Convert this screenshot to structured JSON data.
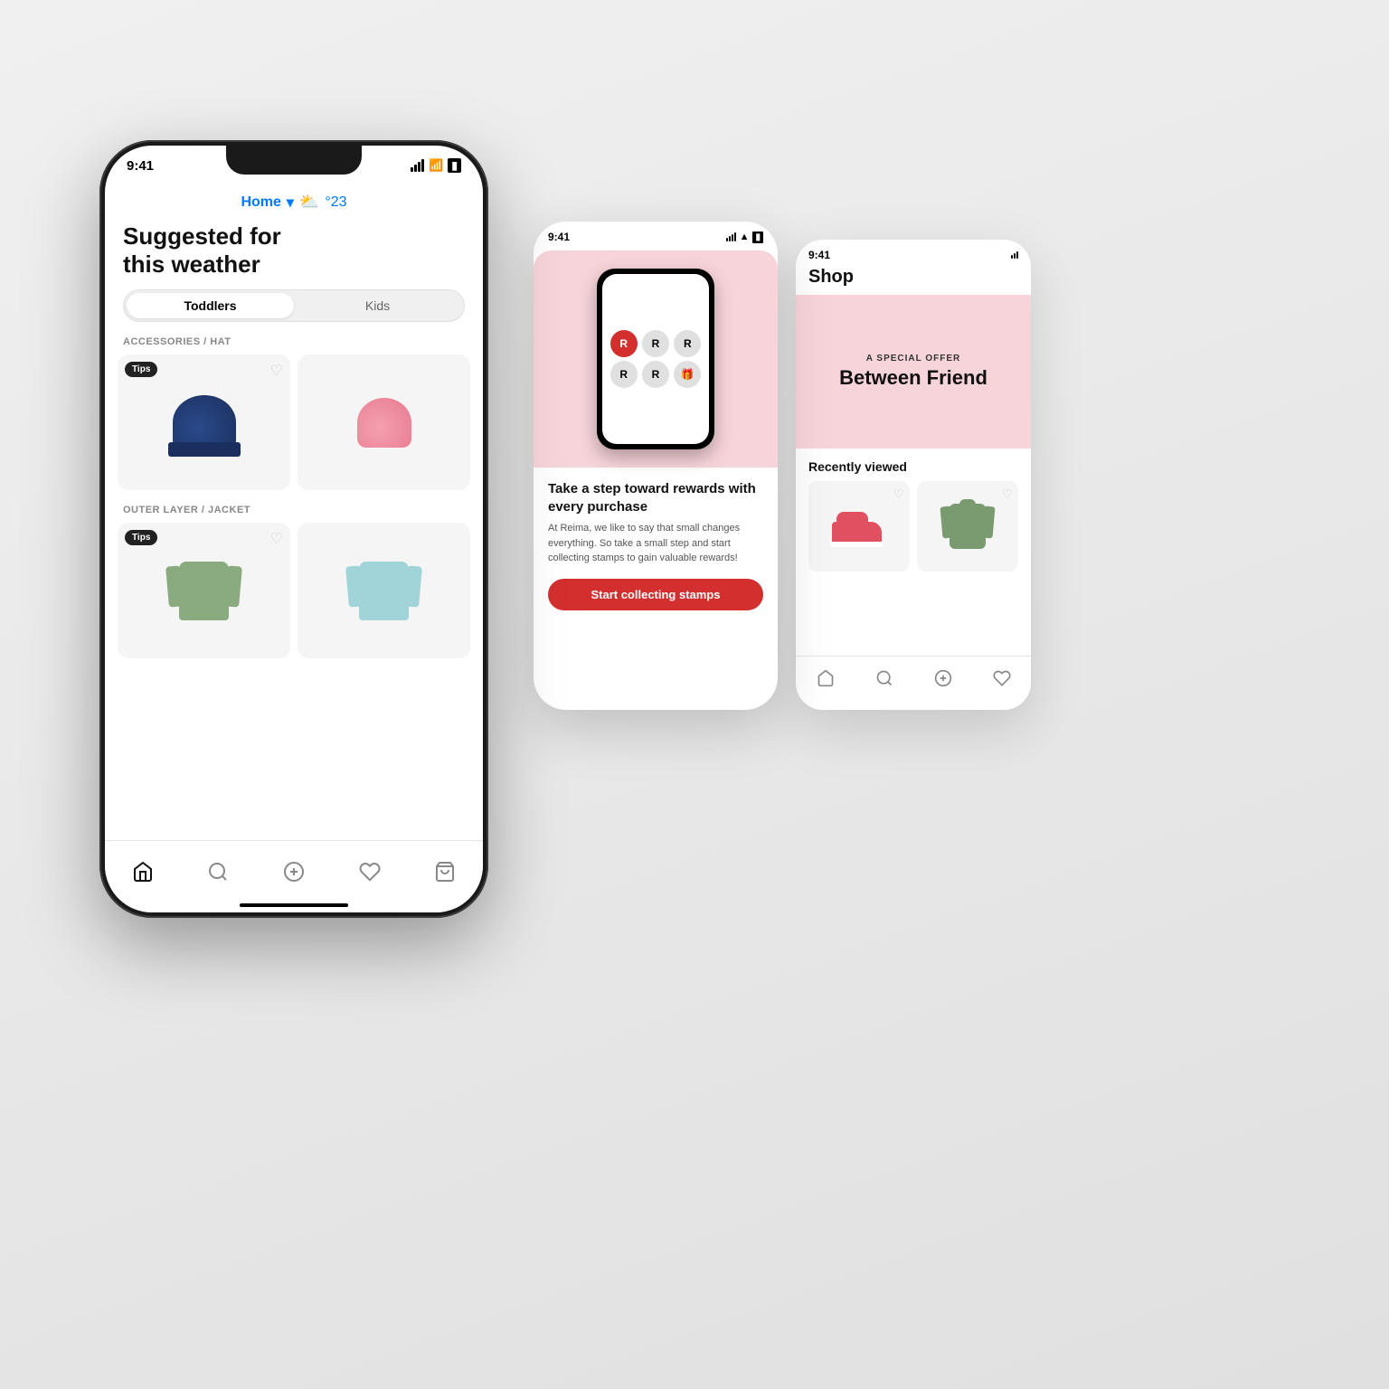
{
  "background": {
    "color": "#e8e8e8"
  },
  "main_phone": {
    "status_bar": {
      "time": "9:41",
      "signal": "signal",
      "wifi": "wifi",
      "battery": "battery"
    },
    "location": {
      "label": "Home",
      "arrow": "▾",
      "weather_emoji": "⛅",
      "temperature": "°23"
    },
    "title": "Suggested for\nthis weather",
    "tabs": [
      "Toddlers",
      "Kids"
    ],
    "active_tab": 0,
    "sections": [
      {
        "category": "ACCESSORIES / HAT",
        "has_tips": true,
        "tips_label": "Tips"
      },
      {
        "category": "OUTER LAYER / JACKET",
        "has_tips": true,
        "tips_label": "Tips"
      }
    ],
    "nav": [
      "🏠",
      "🔍",
      "✦",
      "♡",
      "🛍"
    ]
  },
  "mid_phone": {
    "status_bar": {
      "time": "9:41"
    },
    "rewards_title": "Take a step toward rewards with every purchase",
    "rewards_desc": "At Reima, we like to say that small changes everything. So take a small step and start collecting stamps to gain valuable rewards!",
    "cta_button": "Start collecting stamps",
    "stamps": [
      {
        "type": "filled",
        "label": "R"
      },
      {
        "type": "empty",
        "label": "R"
      },
      {
        "type": "empty",
        "label": "R"
      },
      {
        "type": "empty",
        "label": "R"
      },
      {
        "type": "empty",
        "label": "R"
      },
      {
        "type": "gift",
        "label": "🎁"
      }
    ]
  },
  "right_phone": {
    "status_bar": {
      "time": "9:41"
    },
    "shop_label": "Shop",
    "banner": {
      "sub_label": "A SPECIAL OFFER",
      "title": "Between Friend"
    },
    "recently_label": "Recently viewed",
    "nav": [
      "🏠",
      "🔍",
      "✦",
      "♡"
    ]
  }
}
